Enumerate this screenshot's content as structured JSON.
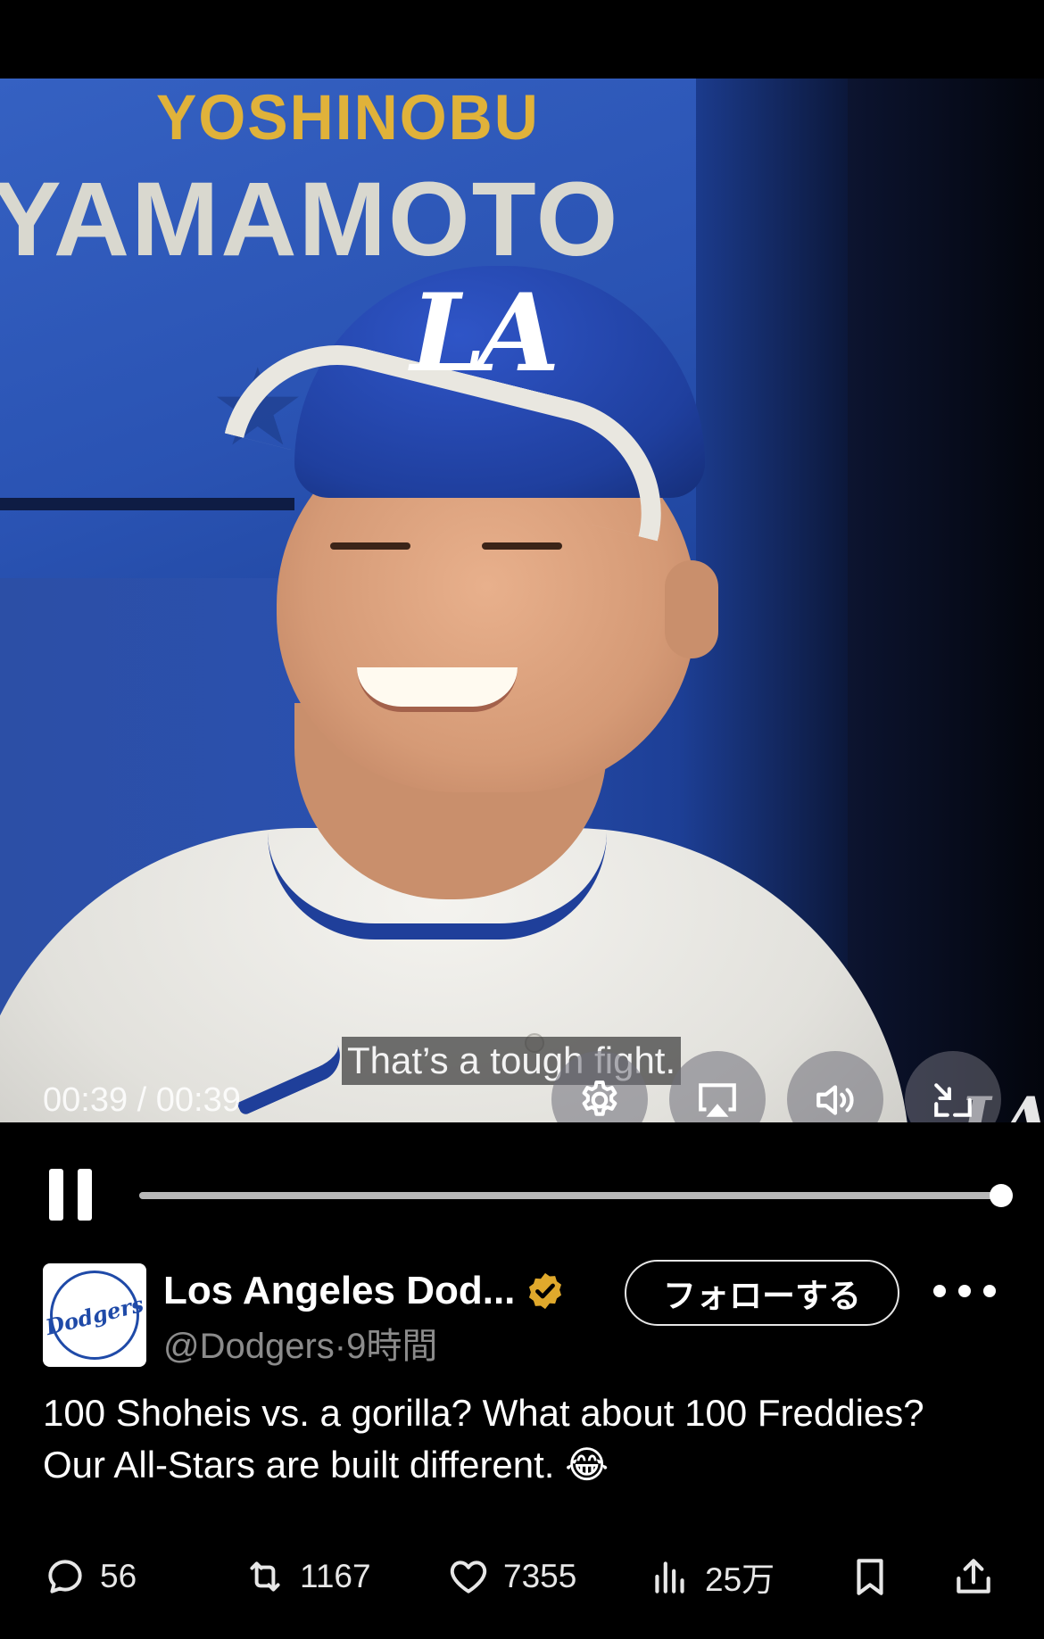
{
  "video": {
    "backdrop": {
      "name_first": "YOSHINOBU",
      "name_last": "YAMAMOTO",
      "cap_logo": "LA",
      "corner_logo": "LA"
    },
    "caption": "That’s a tough fight.",
    "timecode": "00:39 / 00:39",
    "controls": {
      "settings_icon": "gear-icon",
      "airplay_icon": "airplay-icon",
      "volume_icon": "volume-icon",
      "minimize_icon": "exit-fullscreen-icon"
    },
    "progress": 1.0
  },
  "author": {
    "avatar_text": "Dodgers",
    "name": "Los Angeles Dod...",
    "handle": "@Dodgers",
    "separator": "·",
    "time": "9時間",
    "verified_color": "#e0a92c",
    "follow_label": "フォローする"
  },
  "tweet": {
    "text": "100 Shoheis vs. a gorilla? What about 100 Freddies?\nOur All-Stars are built different. 😂"
  },
  "actions": {
    "replies": "56",
    "retweets": "1167",
    "likes": "7355",
    "views": "25万"
  }
}
